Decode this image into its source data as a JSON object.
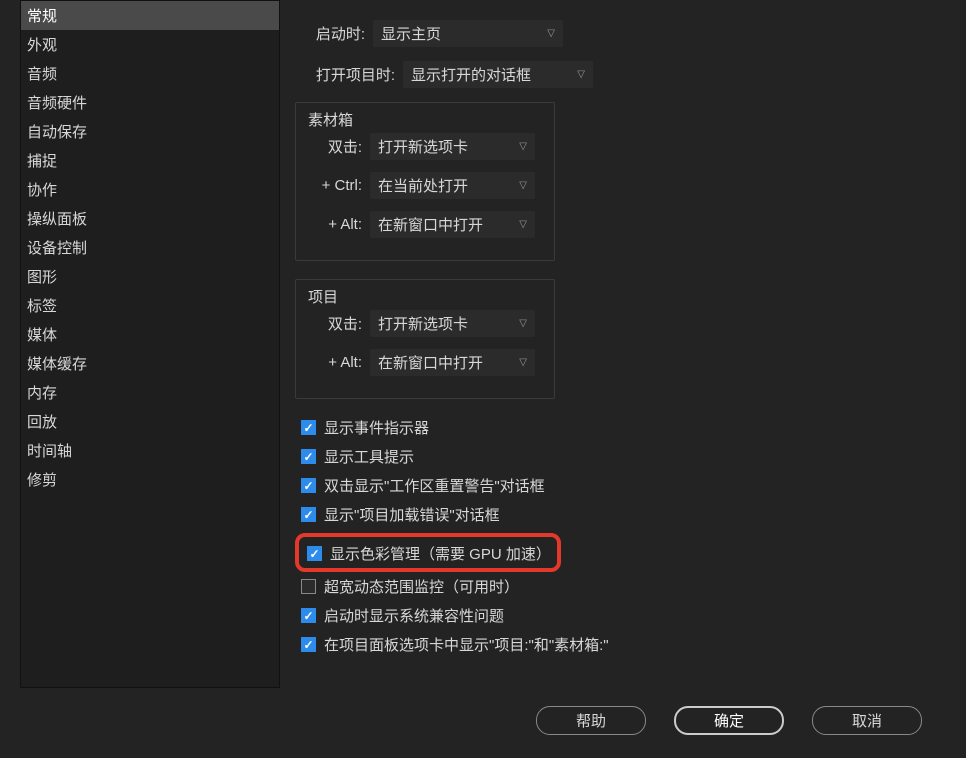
{
  "sidebar": {
    "items": [
      {
        "label": "常规",
        "selected": true
      },
      {
        "label": "外观"
      },
      {
        "label": "音频"
      },
      {
        "label": "音频硬件"
      },
      {
        "label": "自动保存"
      },
      {
        "label": "捕捉"
      },
      {
        "label": "协作"
      },
      {
        "label": "操纵面板"
      },
      {
        "label": "设备控制"
      },
      {
        "label": "图形"
      },
      {
        "label": "标签"
      },
      {
        "label": "媒体"
      },
      {
        "label": "媒体缓存"
      },
      {
        "label": "内存"
      },
      {
        "label": "回放"
      },
      {
        "label": "时间轴"
      },
      {
        "label": "修剪"
      }
    ]
  },
  "top": {
    "startup_label": "启动时:",
    "startup_value": "显示主页",
    "openproj_label": "打开项目时:",
    "openproj_value": "显示打开的对话框"
  },
  "bins": {
    "legend": "素材箱",
    "dbl_label": "双击:",
    "dbl_value": "打开新选项卡",
    "ctrl_label": "+ Ctrl:",
    "ctrl_value": "在当前处打开",
    "alt_label": "+ Alt:",
    "alt_value": "在新窗口中打开"
  },
  "projects": {
    "legend": "项目",
    "dbl_label": "双击:",
    "dbl_value": "打开新选项卡",
    "alt_label": "+ Alt:",
    "alt_value": "在新窗口中打开"
  },
  "checks": {
    "c1": "显示事件指示器",
    "c2": "显示工具提示",
    "c3": "双击显示\"工作区重置警告\"对话框",
    "c4": "显示\"项目加载错误\"对话框",
    "c5": "显示色彩管理（需要 GPU 加速）",
    "c6": "超宽动态范围监控（可用时）",
    "c7": "启动时显示系统兼容性问题",
    "c8": "在项目面板选项卡中显示\"项目:\"和\"素材箱:\""
  },
  "footer": {
    "help": "帮助",
    "ok": "确定",
    "cancel": "取消"
  }
}
